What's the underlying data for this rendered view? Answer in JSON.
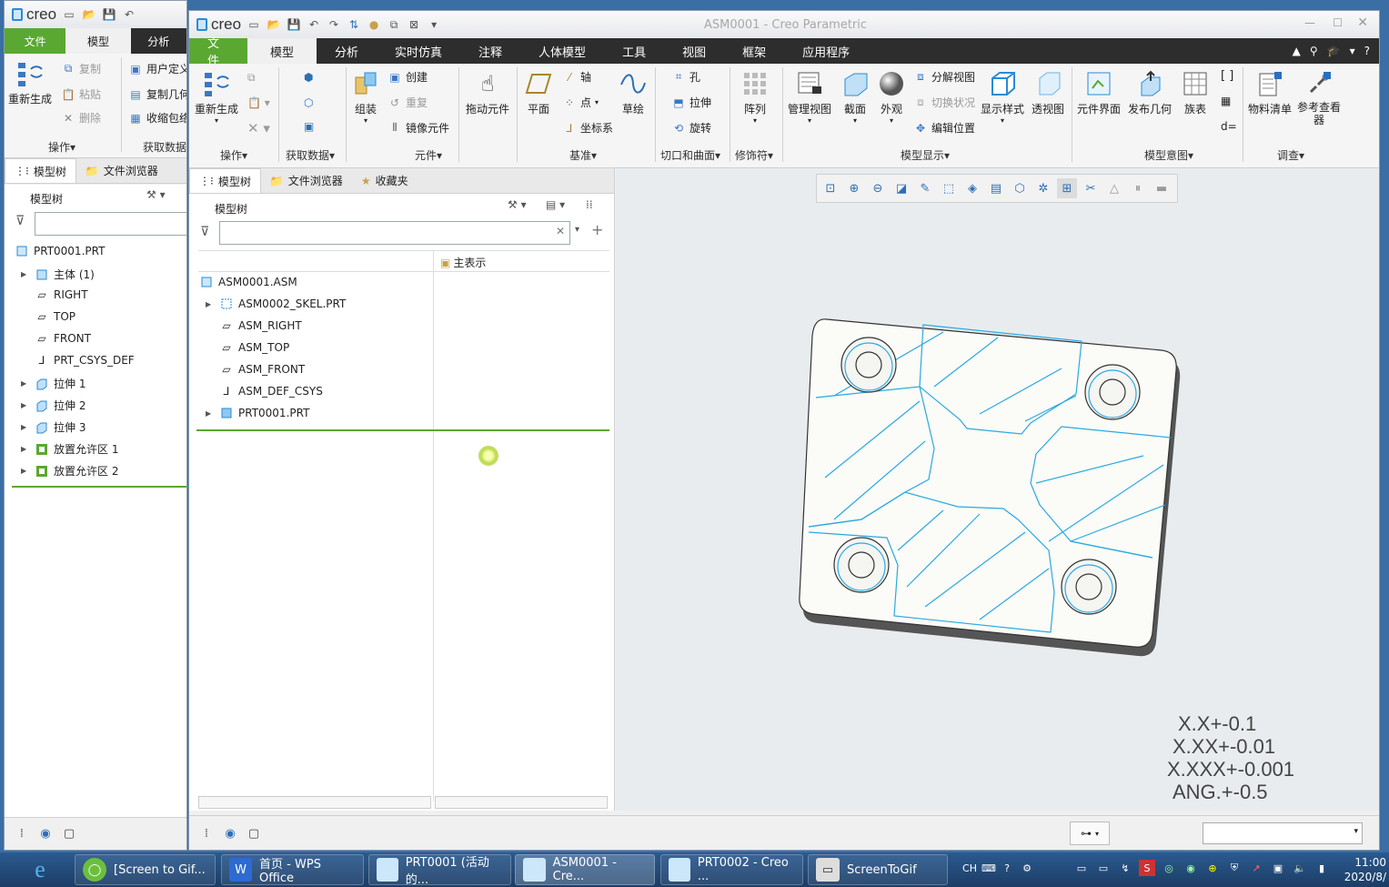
{
  "back_window": {
    "logo": "creo",
    "tabs": [
      "文件",
      "模型",
      "分析"
    ],
    "ribbon": {
      "regen": "重新生成",
      "copy": "复制",
      "paste": "粘贴",
      "delete": "删除",
      "user_def": "用户定义",
      "copy_geom": "复制几何",
      "shrinkwrap": "收缩包络",
      "group_ops": "操作",
      "group_get": "获取数据"
    },
    "panel_tabs": [
      "模型树",
      "文件浏览器"
    ],
    "tree_title": "模型树",
    "tree": [
      "PRT0001.PRT",
      "主体 (1)",
      "RIGHT",
      "TOP",
      "FRONT",
      "PRT_CSYS_DEF",
      "拉伸 1",
      "拉伸 2",
      "拉伸 3",
      "放置允许区 1",
      "放置允许区 2"
    ]
  },
  "window": {
    "logo": "creo",
    "title": "ASM0001 - Creo Parametric",
    "menus": [
      "文件",
      "模型",
      "分析",
      "实时仿真",
      "注释",
      "人体模型",
      "工具",
      "视图",
      "框架",
      "应用程序"
    ],
    "ribbon": {
      "regen": "重新生成",
      "group_ops": "操作",
      "group_get": "获取数据",
      "assemble": "组装",
      "create": "创建",
      "repeat": "重复",
      "mirror": "镜像元件",
      "group_comp": "元件",
      "drag": "拖动元件",
      "plane": "平面",
      "axis": "轴",
      "point": "点",
      "csys": "坐标系",
      "sketch": "草绘",
      "group_datum": "基准",
      "hole": "孔",
      "extrude": "拉伸",
      "revolve": "旋转",
      "group_cut": "切口和曲面",
      "pattern": "阵列",
      "group_mod": "修饰符",
      "manage_view": "管理视图",
      "section": "截面",
      "appearance": "外观",
      "explode": "分解视图",
      "toggle_state": "切换状况",
      "edit_pos": "编辑位置",
      "display_style": "显示样式",
      "perspective": "透视图",
      "group_display": "模型显示",
      "comp_interface": "元件界面",
      "publish_geom": "发布几何",
      "family_table": "族表",
      "group_intent": "模型意图",
      "bom": "物料清单",
      "ref_viewer": "参考查看器",
      "group_investigate": "调查"
    },
    "panel_tabs": [
      "模型树",
      "文件浏览器",
      "收藏夹"
    ],
    "tree_title": "模型树",
    "column": "主表示",
    "tree": [
      "ASM0001.ASM",
      "ASM0002_SKEL.PRT",
      "ASM_RIGHT",
      "ASM_TOP",
      "ASM_FRONT",
      "ASM_DEF_CSYS",
      "PRT0001.PRT"
    ],
    "tolerances": [
      "X.X+-0.1",
      "X.XX+-0.01",
      "X.XXX+-0.001",
      "ANG.+-0.5"
    ]
  },
  "taskbar": {
    "items": [
      "[Screen to Gif...",
      "首页 - WPS Office",
      "PRT0001 (活动的...",
      "ASM0001 - Cre...",
      "PRT0002 - Creo ...",
      "ScreenToGif"
    ],
    "lang": "CH",
    "time": "11:00",
    "date": "2020/8/"
  },
  "colors": {
    "accent": "#5aa832",
    "menubar": "#2d2d2d",
    "edge": "#2aa9e0"
  }
}
